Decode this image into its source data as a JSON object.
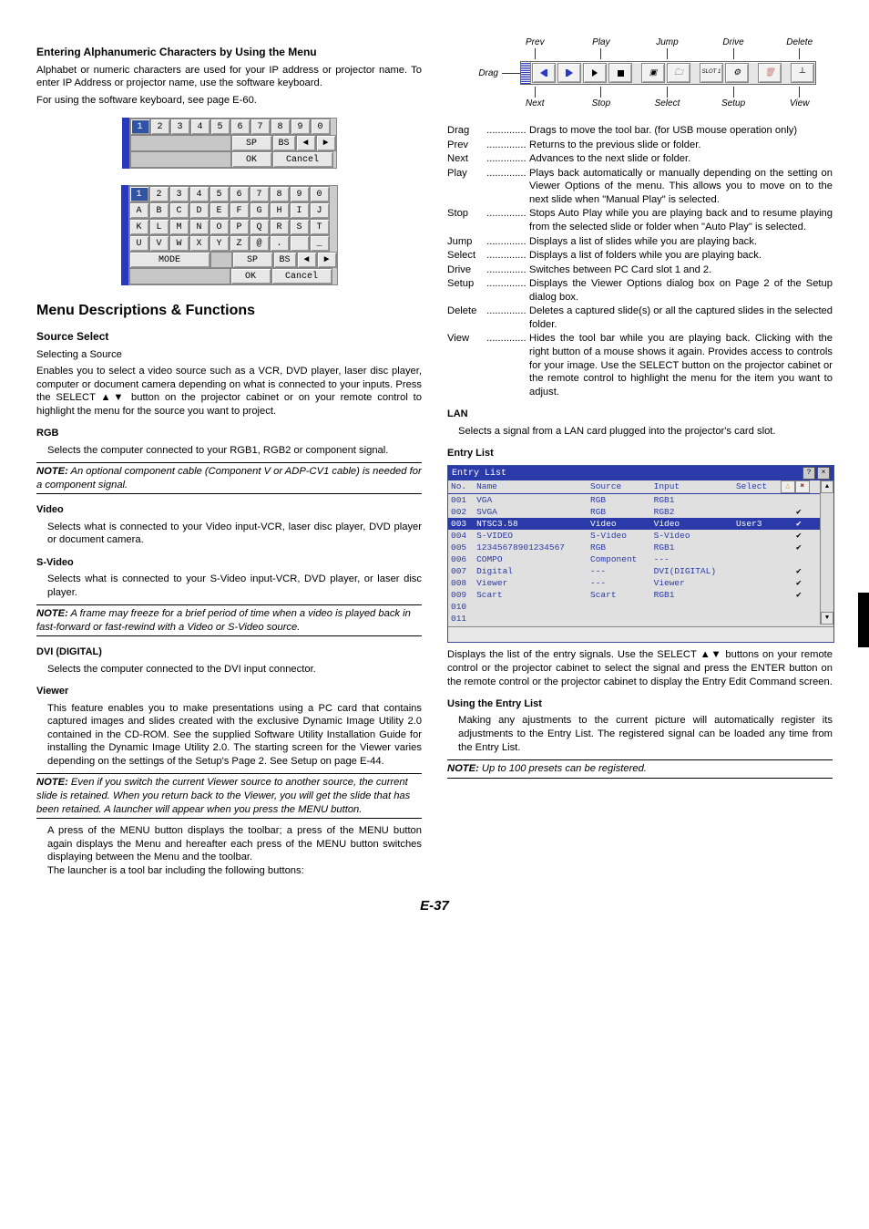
{
  "left": {
    "head1": "Entering Alphanumeric Characters by Using the Menu",
    "p1": "Alphabet or numeric characters are used for your IP address or projector name. To enter IP Address or projector name, use the software keyboard.",
    "p2": "For using the software keyboard, see page E-60.",
    "kbd1": {
      "r1": [
        "1",
        "2",
        "3",
        "4",
        "5",
        "6",
        "7",
        "8",
        "9",
        "0"
      ],
      "r2_sp": "SP",
      "r2_bs": "BS",
      "r2_l": "◄",
      "r2_r": "►",
      "r3_ok": "OK",
      "r3_cancel": "Cancel"
    },
    "kbd2": {
      "r1": [
        "1",
        "2",
        "3",
        "4",
        "5",
        "6",
        "7",
        "8",
        "9",
        "0"
      ],
      "r2": [
        "A",
        "B",
        "C",
        "D",
        "E",
        "F",
        "G",
        "H",
        "I",
        "J"
      ],
      "r3": [
        "K",
        "L",
        "M",
        "N",
        "O",
        "P",
        "Q",
        "R",
        "S",
        "T"
      ],
      "r4": [
        "U",
        "V",
        "W",
        "X",
        "Y",
        "Z",
        "@",
        ".",
        "",
        "_"
      ],
      "mode": "MODE",
      "sp": "SP",
      "bs": "BS",
      "l": "◄",
      "r": "►",
      "ok": "OK",
      "cancel": "Cancel"
    },
    "head2": "Menu Descriptions & Functions",
    "srcsel": "Source Select",
    "selsrc": "Selecting a Source",
    "srcsel_p": "Enables you to select a video source such as a VCR, DVD player, laser disc player, computer or document camera depending on what is connected to your inputs. Press the SELECT ▲▼ button on the projector cabinet or on your remote control to highlight the menu for the source you want to project.",
    "rgb_h": "RGB",
    "rgb_p": "Selects the computer connected to your RGB1, RGB2 or component signal.",
    "note1_label": "NOTE:",
    "note1": "An optional component cable (Component V or ADP-CV1 cable) is needed for a component signal.",
    "video_h": "Video",
    "video_p": "Selects what is connected to your Video input-VCR, laser disc player, DVD player or document camera.",
    "svideo_h": "S-Video",
    "svideo_p": "Selects what is connected to your S-Video input-VCR, DVD player, or laser disc player.",
    "note2": "A frame may freeze for a brief period of time when a video is played back in fast-forward or fast-rewind with a Video or S-Video source.",
    "dvi_h": "DVI (DIGITAL)",
    "dvi_p": "Selects the computer connected to the DVI input connector.",
    "viewer_h": "Viewer",
    "viewer_p": "This feature enables you to make presentations using a PC card that contains captured images and slides created with the exclusive Dynamic Image Utility 2.0 contained in the CD-ROM. See the supplied Software Utility Installation Guide for installing the Dynamic Image Utility 2.0. The starting screen for the Viewer varies depending on the settings of the Setup's Page 2. See Setup on page E-44.",
    "note3": "Even if you switch the current Viewer source to another source, the current slide is retained. When you return back to the Viewer, you will get the slide that has been retained. A launcher will appear when you press the MENU button.",
    "toolbar_p": "A press of the MENU button displays the toolbar; a press of the MENU button again displays the Menu and hereafter each press of the MENU button switches displaying between the Menu and the toolbar.\nThe launcher is a tool bar including the following buttons:"
  },
  "right": {
    "labels_top": [
      "Prev",
      "Play",
      "Jump",
      "Drive",
      "Delete"
    ],
    "drag": "Drag",
    "labels_bottom": [
      "Next",
      "Stop",
      "Select",
      "Setup",
      "View"
    ],
    "slot": "SLOT 1",
    "defs": [
      {
        "t": "Drag",
        "d": "Drags to move the tool bar. (for USB mouse operation only)"
      },
      {
        "t": "Prev",
        "d": "Returns to the previous slide or folder."
      },
      {
        "t": "Next",
        "d": "Advances to the next slide or folder."
      },
      {
        "t": "Play",
        "d": "Plays back automatically or manually depending on the setting on Viewer Options of the menu. This allows you to move on to the next slide when \"Manual Play\" is selected."
      },
      {
        "t": "Stop",
        "d": "Stops Auto Play while you are playing back and to resume playing from the selected slide or folder when \"Auto Play\" is selected."
      },
      {
        "t": "Jump",
        "d": "Displays a list of slides while you are playing back."
      },
      {
        "t": "Select",
        "d": "Displays a list of folders while you are playing back."
      },
      {
        "t": "Drive",
        "d": "Switches between PC Card slot 1 and 2."
      },
      {
        "t": "Setup",
        "d": "Displays the Viewer Options dialog box on Page 2 of the Setup dialog box."
      },
      {
        "t": "Delete",
        "d": "Deletes a captured slide(s) or all the captured slides in the selected folder."
      },
      {
        "t": "View",
        "d": "Hides the tool bar while you are playing back. Clicking with the right button of a mouse shows it again. Provides access to controls for your image. Use the SELECT button on the projector cabinet or the remote control to highlight the menu for the item you want to adjust."
      }
    ],
    "lan_h": "LAN",
    "lan_p": "Selects a signal from a LAN card plugged into the projector's card slot.",
    "el_h": "Entry List",
    "entry_list": {
      "title": "Entry List",
      "help": "?",
      "close": "×",
      "cols": [
        "No.",
        "Name",
        "Source",
        "Input",
        "Select",
        ""
      ],
      "icon_up": "△",
      "icon_x": "✖",
      "rows": [
        {
          "no": "001",
          "name": "VGA",
          "src": "RGB",
          "inp": "RGB1",
          "sel": "",
          "chk": ""
        },
        {
          "no": "002",
          "name": "SVGA",
          "src": "RGB",
          "inp": "RGB2",
          "sel": "",
          "chk": "✔"
        },
        {
          "no": "003",
          "name": "NTSC3.58",
          "src": "Video",
          "inp": "Video",
          "sel": "User3",
          "chk": "✔",
          "hl": true
        },
        {
          "no": "004",
          "name": "S-VIDEO",
          "src": "S-Video",
          "inp": "S-Video",
          "sel": "",
          "chk": "✔"
        },
        {
          "no": "005",
          "name": "12345678901234567",
          "src": "RGB",
          "inp": "RGB1",
          "sel": "",
          "chk": "✔"
        },
        {
          "no": "006",
          "name": "COMPO",
          "src": "Component",
          "inp": "---",
          "sel": "",
          "chk": ""
        },
        {
          "no": "007",
          "name": "Digital",
          "src": "---",
          "inp": "DVI(DIGITAL)",
          "sel": "",
          "chk": "✔"
        },
        {
          "no": "008",
          "name": "Viewer",
          "src": "---",
          "inp": "Viewer",
          "sel": "",
          "chk": "✔"
        },
        {
          "no": "009",
          "name": "Scart",
          "src": "Scart",
          "inp": "RGB1",
          "sel": "",
          "chk": "✔"
        },
        {
          "no": "010",
          "name": "",
          "src": "",
          "inp": "",
          "sel": "",
          "chk": ""
        },
        {
          "no": "011",
          "name": "",
          "src": "",
          "inp": "",
          "sel": "",
          "chk": ""
        }
      ]
    },
    "el_p1": "Displays the list of the entry signals. Use the SELECT ▲▼ buttons on your remote control or the projector cabinet to select the signal and press the ENTER button on the remote control or the projector cabinet to display the Entry Edit Command screen.",
    "uel_h": "Using the Entry List",
    "uel_p": "Making any ajustments to the current picture will automatically register its adjustments to the Entry List. The registered signal can be loaded any time from the Entry List.",
    "note4_label": "NOTE:",
    "note4": "Up to 100 presets can be registered."
  },
  "pagenum": "E-37"
}
